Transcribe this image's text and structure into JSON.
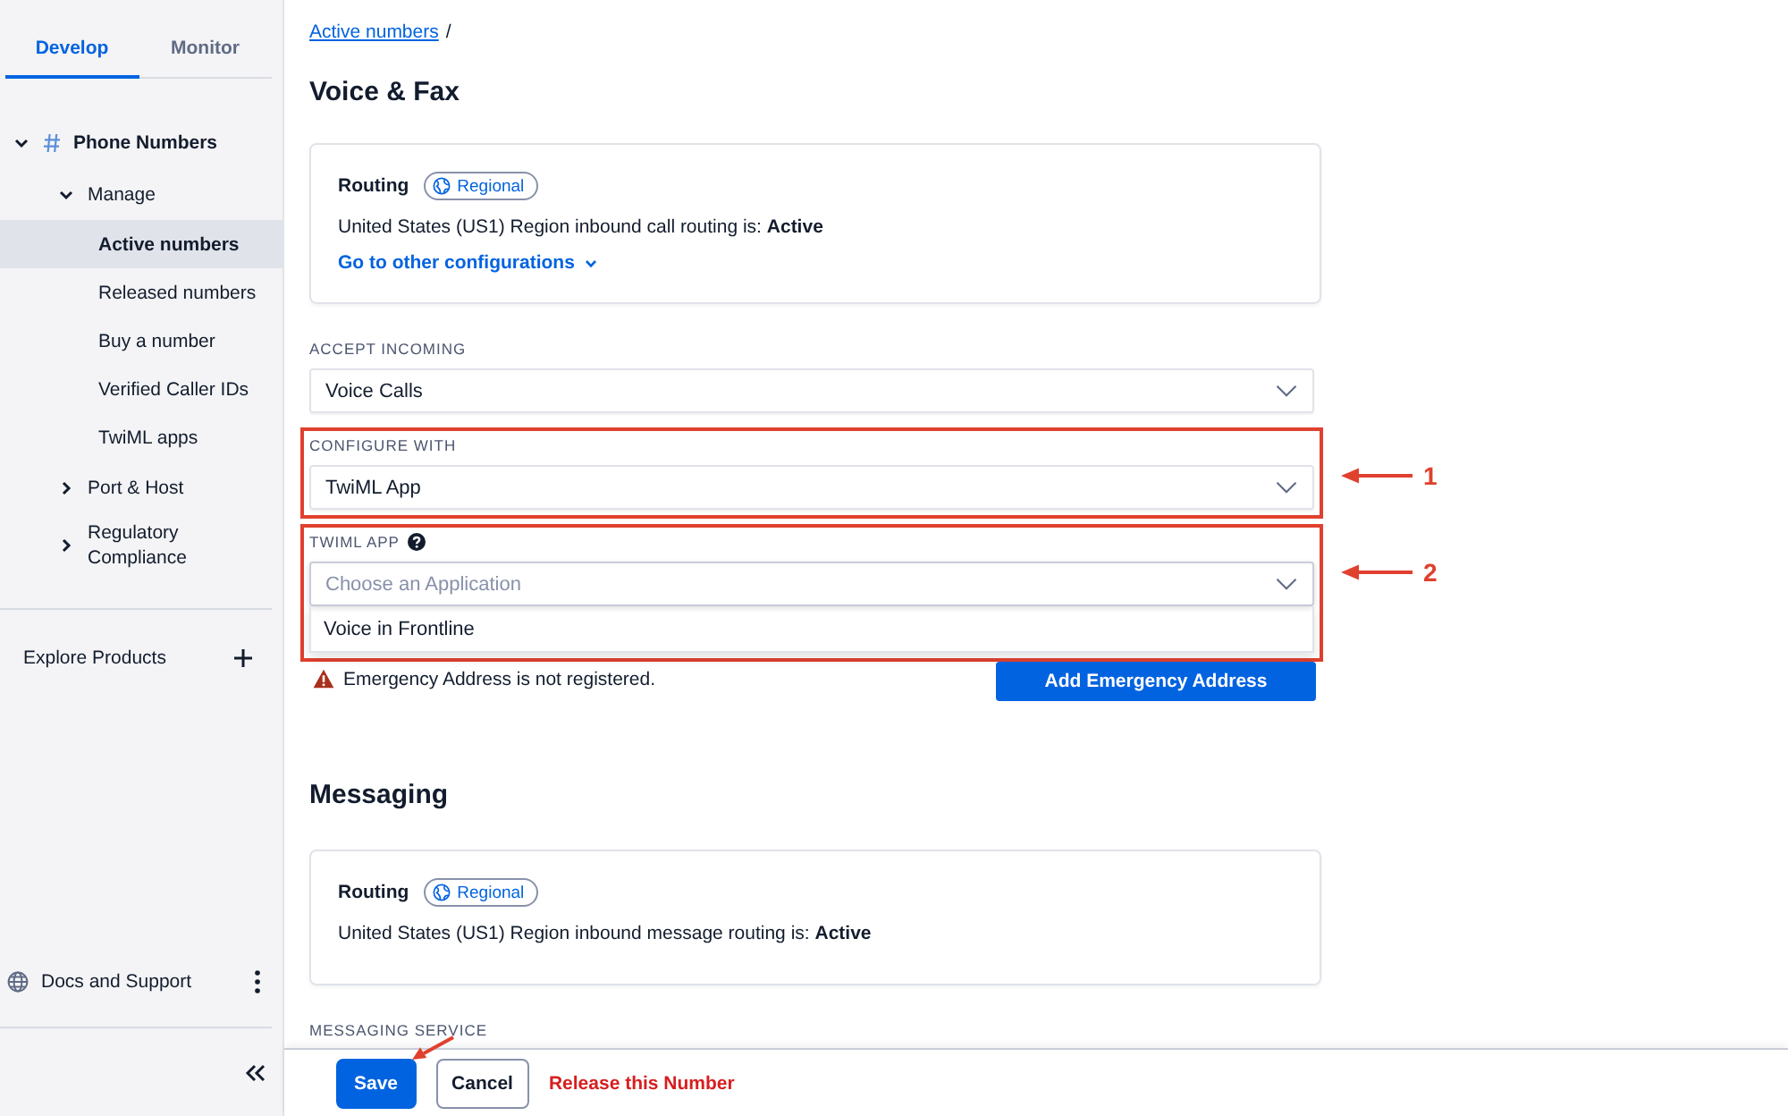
{
  "sidebar": {
    "tabs": [
      {
        "label": "Develop",
        "selected": true
      },
      {
        "label": "Monitor",
        "selected": false
      }
    ],
    "tree": [
      {
        "label": "Phone Numbers",
        "expanded": true,
        "selected": false,
        "children": [
          {
            "label": "Manage",
            "expanded": true,
            "selected": false,
            "children": [
              {
                "label": "Active numbers",
                "selected": true
              },
              {
                "label": "Released numbers",
                "selected": false
              },
              {
                "label": "Buy a number",
                "selected": false
              },
              {
                "label": "Verified Caller IDs",
                "selected": false
              },
              {
                "label": "TwiML apps",
                "selected": false
              }
            ]
          },
          {
            "label": "Port & Host",
            "expanded": false,
            "selected": false
          },
          {
            "label": "Regulatory Compliance",
            "expanded": false,
            "selected": false
          }
        ]
      }
    ],
    "explore": "Explore Products",
    "docs": "Docs and Support"
  },
  "breadcrumb": {
    "link": "Active numbers",
    "separator": "/"
  },
  "sections": [
    {
      "title": "Voice & Fax",
      "routing": {
        "title": "Routing",
        "badge": "Regional",
        "status": "United States (US1) Region inbound call routing is: **Active**",
        "link": "Go to other configurations"
      },
      "fields": [
        {
          "label": "ACCEPT INCOMING",
          "value": "Voice Calls",
          "highlighted": false
        },
        {
          "label": "CONFIGURE WITH",
          "value": "TwiML App",
          "highlighted": true,
          "callout": "1"
        },
        {
          "label": "TWIML APP",
          "help": true,
          "placeholder": "Choose an Application",
          "expanded": true,
          "options": [
            "Voice in Frontline"
          ],
          "highlighted": true,
          "callout": "2"
        }
      ],
      "warning": {
        "text": "Emergency Address is not registered.",
        "button": "Add Emergency Address"
      }
    },
    {
      "title": "Messaging",
      "routing": {
        "title": "Routing",
        "badge": "Regional",
        "status": "United States (US1) Region inbound message routing is: **Active**"
      },
      "fields": [
        {
          "label": "MESSAGING SERVICE",
          "highlighted": false
        }
      ]
    }
  ],
  "footer": {
    "buttons": [
      {
        "label": "Save",
        "kind": "primary",
        "annotated": true
      },
      {
        "label": "Cancel",
        "kind": "secondary",
        "annotated": false
      },
      {
        "label": "Release this Number",
        "kind": "danger",
        "annotated": false
      }
    ]
  }
}
